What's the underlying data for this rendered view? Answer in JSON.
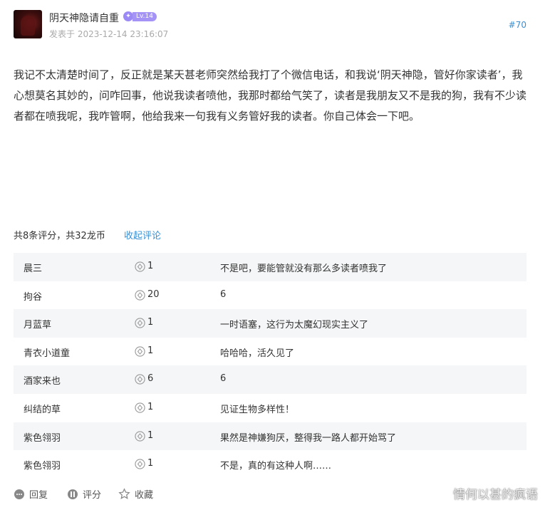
{
  "post": {
    "username": "阴天神隐请自重",
    "level": "Lv.14",
    "posted_at": "发表于 2023-12-14 23:16:07",
    "floor": "#70",
    "content": "我记不太清楚时间了，反正就是某天甚老师突然给我打了个微信电话，和我说‘阴天神隐，管好你家读者’，我心想莫名其妙的，问咋回事，他说我读者喷他，我那时都给气笑了，读者是我朋友又不是我的狗，我有不少读者都在喷我呢，我咋管啊，他给我来一句我有义务管好我的读者。你自己体会一下吧。"
  },
  "ratings": {
    "summary": "共8条评分，共32龙币",
    "collapse_label": "收起评论",
    "rows": [
      {
        "name": "晨三",
        "score": "1",
        "comment": "不是吧，要能管就没有那么多读者喷我了"
      },
      {
        "name": "拘谷",
        "score": "20",
        "comment": "6"
      },
      {
        "name": "月蓝草",
        "score": "1",
        "comment": "一时语塞，这行为太魔幻现实主义了"
      },
      {
        "name": "青衣小道童",
        "score": "1",
        "comment": "哈哈哈，活久见了"
      },
      {
        "name": "酒家来也",
        "score": "6",
        "comment": "6"
      },
      {
        "name": "纠结的草",
        "score": "1",
        "comment": "见证生物多样性！"
      },
      {
        "name": "紫色翎羽",
        "score": "1",
        "comment": "果然是神嫌狗厌，整得我一路人都开始骂了"
      },
      {
        "name": "紫色翎羽",
        "score": "1",
        "comment": "不是，真的有这种人啊……"
      }
    ]
  },
  "actions": {
    "reply": "回复",
    "rate": "评分",
    "favorite": "收藏"
  },
  "watermark": "情何以甚的疯语",
  "icons": {
    "coin": "coin-icon",
    "reply": "reply-icon",
    "rate": "rate-icon",
    "favorite": "star-icon",
    "weibo": "weibo-icon"
  },
  "colors": {
    "accent": "#3a8fd3",
    "level_badge": "#a593f6",
    "row_stripe": "#f5f6f7"
  }
}
